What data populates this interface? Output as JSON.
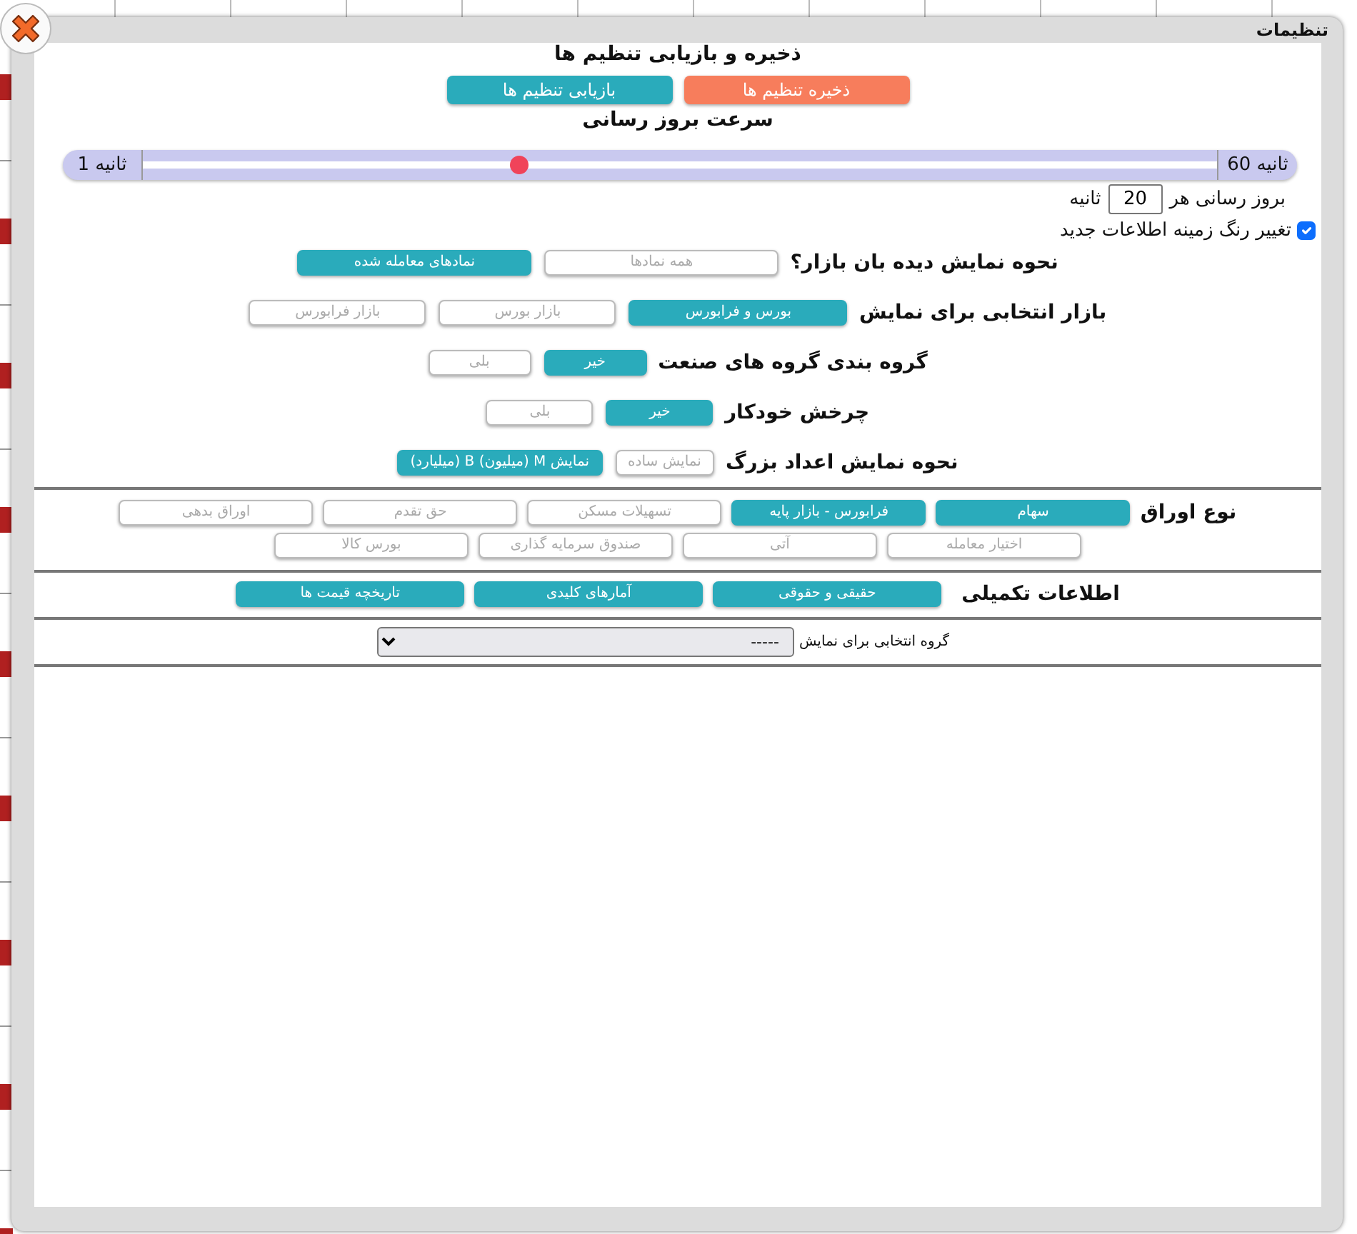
{
  "dialog": {
    "title": "تنظیمات"
  },
  "backup": {
    "heading": "ذخیره و بازیابی تنظیم ها",
    "buttons": [
      {
        "label": "ذخیره تنظیم ها",
        "kind": "save"
      },
      {
        "label": "بازیابی تنظیم ها",
        "kind": "restore"
      }
    ]
  },
  "refresh_speed": {
    "heading": "سرعت بروز رسانی",
    "max_label": "ثانیه 60",
    "min_label": "ثانیه 1",
    "level": 0.35
  },
  "refresh_interval": {
    "prefix": "بروز رسانی هر",
    "value": "20",
    "suffix": "ثانیه"
  },
  "highlight_new": {
    "label": "تغییر رنگ زمینه اطلاعات جدید",
    "checked": true
  },
  "option_rows": [
    {
      "label": "نحوه نمایش دیده بان بازار؟",
      "options": [
        {
          "label": "همه نمادها",
          "selected": false
        },
        {
          "label": "نمادهای معامله شده",
          "selected": true
        }
      ]
    },
    {
      "label": "بازار انتخابی برای نمایش",
      "options": [
        {
          "label": "بورس و فرابورس",
          "selected": true
        },
        {
          "label": "بازار بورس",
          "selected": false
        },
        {
          "label": "بازار فرابورس",
          "selected": false
        }
      ]
    },
    {
      "label": "گروه بندی گروه های صنعت",
      "options": [
        {
          "label": "خیر",
          "selected": true
        },
        {
          "label": "بلی",
          "selected": false
        }
      ]
    },
    {
      "label": "چرخش خودکار",
      "options": [
        {
          "label": "خیر",
          "selected": true
        },
        {
          "label": "بلی",
          "selected": false
        }
      ]
    },
    {
      "label": "نحوه نمایش اعداد بزرگ",
      "options": [
        {
          "label": "نمایش ساده",
          "selected": false
        },
        {
          "label": "نمایش M (میلیون) B (میلیارد)",
          "selected": true
        }
      ]
    }
  ],
  "security_types": {
    "label": "نوع اوراق",
    "options": [
      {
        "label": "سهام",
        "selected": true
      },
      {
        "label": "فرابورس - بازار پایه",
        "selected": true
      },
      {
        "label": "تسهیلات مسکن",
        "selected": false
      },
      {
        "label": "حق تقدم",
        "selected": false
      },
      {
        "label": "اوراق بدهی",
        "selected": false
      },
      {
        "label": "اختیار معامله",
        "selected": false
      },
      {
        "label": "آتی",
        "selected": false
      },
      {
        "label": "صندوق سرمایه گذاری",
        "selected": false
      },
      {
        "label": "بورس کالا",
        "selected": false
      }
    ]
  },
  "extra_info": {
    "label": "اطلاعات تکمیلی",
    "buttons": [
      "حقیقی و حقوقی",
      "آمارهای کلیدی",
      "تاریخچه قیمت ها"
    ]
  },
  "group_select": {
    "label": "گروه انتخابی برای نمایش",
    "value": "-----"
  }
}
